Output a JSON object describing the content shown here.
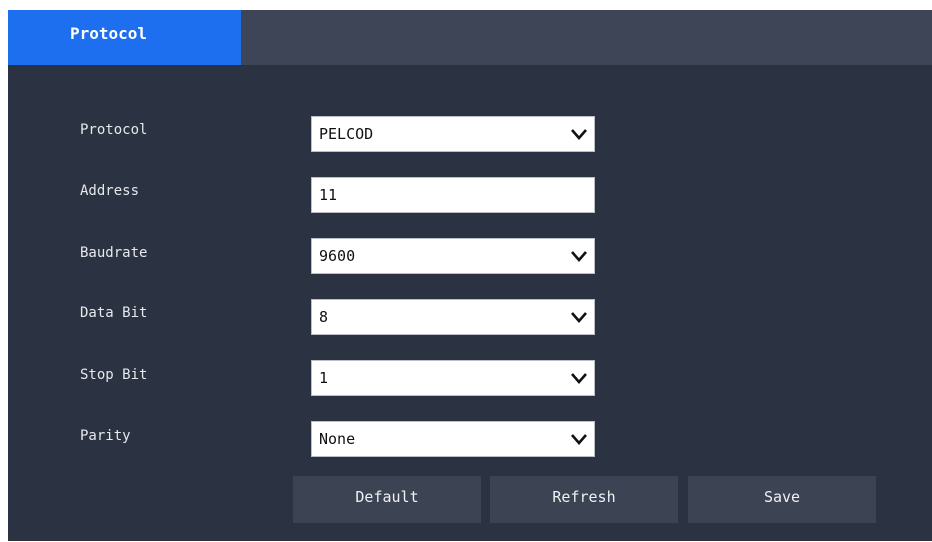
{
  "tab": {
    "label": "Protocol"
  },
  "form": {
    "protocol": {
      "label": "Protocol",
      "value": "PELCOD"
    },
    "address": {
      "label": "Address",
      "value": "11"
    },
    "baudrate": {
      "label": "Baudrate",
      "value": "9600"
    },
    "data_bit": {
      "label": "Data Bit",
      "value": "8"
    },
    "stop_bit": {
      "label": "Stop Bit",
      "value": "1"
    },
    "parity": {
      "label": "Parity",
      "value": "None"
    }
  },
  "buttons": {
    "default_label": "Default",
    "refresh_label": "Refresh",
    "save_label": "Save"
  },
  "icons": {
    "dropdown": "chevron-down-icon"
  },
  "colors": {
    "tab_active": "#1e6ef0",
    "panel_bg": "#2b3342",
    "tabbar_bg": "#3d4556",
    "button_bg": "#3c4454"
  }
}
